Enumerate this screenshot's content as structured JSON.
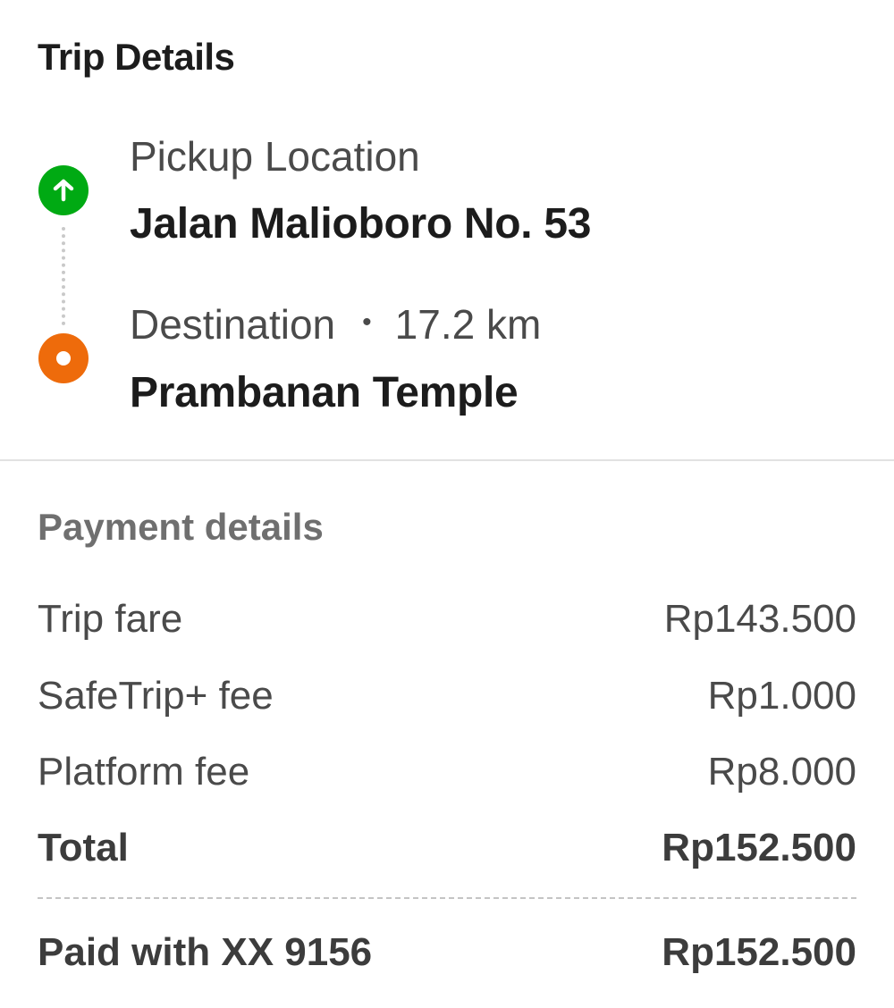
{
  "trip": {
    "title": "Trip Details",
    "pickup": {
      "label": "Pickup Location",
      "value": "Jalan Malioboro No. 53"
    },
    "destination": {
      "label": "Destination",
      "separator": "•",
      "distance": "17.2 km",
      "value": "Prambanan Temple"
    }
  },
  "payment": {
    "title": "Payment details",
    "rows": [
      {
        "label": "Trip fare",
        "value": "Rp143.500"
      },
      {
        "label": "SafeTrip+ fee",
        "value": "Rp1.000"
      },
      {
        "label": "Platform fee",
        "value": "Rp8.000"
      }
    ],
    "total": {
      "label": "Total",
      "value": "Rp152.500"
    },
    "paid": {
      "label": "Paid with XX 9156",
      "value": "Rp152.500"
    }
  },
  "colors": {
    "pickup_pin": "#00aa13",
    "destination_pin": "#ee6b0b"
  },
  "icons": {
    "pickup": "arrow-up-icon",
    "destination": "destination-dot-icon"
  }
}
